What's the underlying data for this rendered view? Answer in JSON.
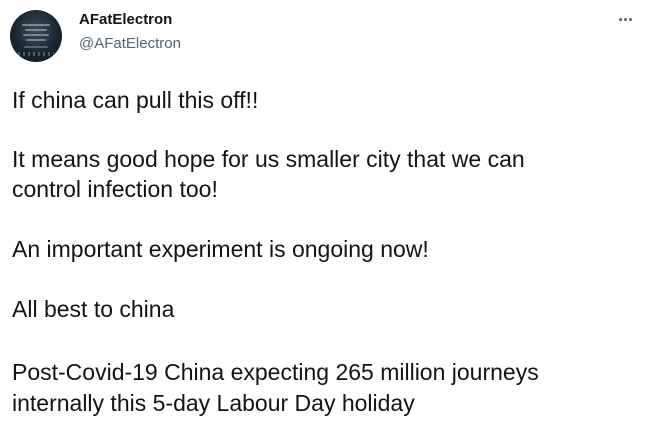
{
  "author": {
    "display_name": "AFatElectron",
    "handle": "@AFatElectron",
    "avatar_icon": "book-cover-avatar"
  },
  "menu": {
    "icon": "more-options-icon",
    "glyph": "..."
  },
  "tweet": {
    "lines": [
      "If china can pull this off!!",
      "It means good hope for us smaller city that we can",
      "control infection too!",
      "An important experiment is ongoing now!",
      "All best to china",
      "Post-Covid-19 China expecting 265 million journeys",
      "internally this 5-day Labour Day holiday"
    ]
  },
  "colors": {
    "text": "#0f1419",
    "secondary": "#536471",
    "background": "#ffffff"
  }
}
